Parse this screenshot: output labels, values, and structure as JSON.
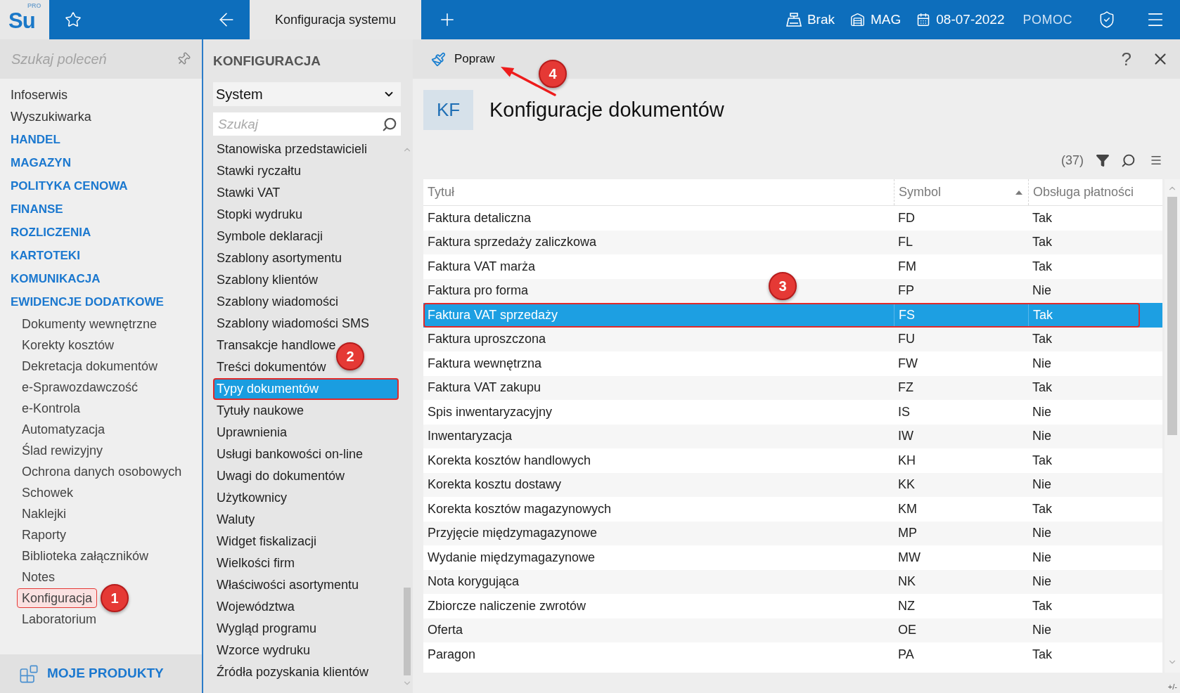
{
  "top_bar": {
    "logo": {
      "text": "Su",
      "superscript": "PRO"
    },
    "tab": "Konfiguracja systemu",
    "status_items": [
      {
        "kind": "register",
        "label": "Brak"
      },
      {
        "kind": "warehouse",
        "label": "MAG"
      },
      {
        "kind": "calendar",
        "label": "08-07-2022"
      }
    ],
    "help_link": "POMOC"
  },
  "sidebar": {
    "search": {
      "placeholder": "Szukaj poleceń"
    },
    "items": [
      {
        "kind": "link",
        "label": "Infoserwis"
      },
      {
        "kind": "link",
        "label": "Wyszukiwarka"
      },
      {
        "kind": "section",
        "label": "HANDEL"
      },
      {
        "kind": "section",
        "label": "MAGAZYN"
      },
      {
        "kind": "section",
        "label": "POLITYKA CENOWA"
      },
      {
        "kind": "section",
        "label": "FINANSE"
      },
      {
        "kind": "section",
        "label": "ROZLICZENIA"
      },
      {
        "kind": "section",
        "label": "KARTOTEKI"
      },
      {
        "kind": "section",
        "label": "KOMUNIKACJA"
      },
      {
        "kind": "section",
        "label": "EWIDENCJE DODATKOWE",
        "children": [
          {
            "label": "Dokumenty wewnętrzne",
            "highlighted": false
          },
          {
            "label": "Korekty kosztów",
            "highlighted": false
          },
          {
            "label": "Dekretacja dokumentów",
            "highlighted": false
          },
          {
            "label": "e-Sprawozdawczość",
            "highlighted": false
          },
          {
            "label": "e-Kontrola",
            "highlighted": false
          },
          {
            "label": "Automatyzacja",
            "highlighted": false
          },
          {
            "label": "Ślad rewizyjny",
            "highlighted": false
          },
          {
            "label": "Ochrona danych osobowych",
            "highlighted": false
          },
          {
            "label": "Schowek",
            "highlighted": false
          },
          {
            "label": "Naklejki",
            "highlighted": false
          },
          {
            "label": "Raporty",
            "highlighted": false
          },
          {
            "label": "Biblioteka załączników",
            "highlighted": false
          },
          {
            "label": "Notes",
            "highlighted": false
          },
          {
            "label": "Konfiguracja",
            "highlighted": true,
            "callout": "1"
          },
          {
            "label": "Laboratorium",
            "highlighted": false
          }
        ]
      }
    ],
    "footer": "MOJE PRODUKTY"
  },
  "config_panel": {
    "title": "KONFIGURACJA",
    "dropdown": {
      "value": "System"
    },
    "search": {
      "placeholder": "Szukaj"
    },
    "items": [
      {
        "label": "Stanowiska przedstawicieli",
        "selected": false,
        "highlighted": false
      },
      {
        "label": "Stawki ryczałtu",
        "selected": false,
        "highlighted": false
      },
      {
        "label": "Stawki VAT",
        "selected": false,
        "highlighted": false
      },
      {
        "label": "Stopki wydruku",
        "selected": false,
        "highlighted": false
      },
      {
        "label": "Symbole deklaracji",
        "selected": false,
        "highlighted": false
      },
      {
        "label": "Szablony asortymentu",
        "selected": false,
        "highlighted": false
      },
      {
        "label": "Szablony klientów",
        "selected": false,
        "highlighted": false
      },
      {
        "label": "Szablony wiadomości",
        "selected": false,
        "highlighted": false
      },
      {
        "label": "Szablony wiadomości SMS",
        "selected": false,
        "highlighted": false
      },
      {
        "label": "Transakcje handlowe",
        "selected": false,
        "highlighted": false
      },
      {
        "label": "Treści dokumentów",
        "selected": false,
        "highlighted": false
      },
      {
        "label": "Typy dokumentów",
        "selected": true,
        "highlighted": true,
        "callout": "2"
      },
      {
        "label": "Tytuły naukowe",
        "selected": false,
        "highlighted": false
      },
      {
        "label": "Uprawnienia",
        "selected": false,
        "highlighted": false
      },
      {
        "label": "Usługi bankowości on-line",
        "selected": false,
        "highlighted": false
      },
      {
        "label": "Uwagi do dokumentów",
        "selected": false,
        "highlighted": false
      },
      {
        "label": "Użytkownicy",
        "selected": false,
        "highlighted": false
      },
      {
        "label": "Waluty",
        "selected": false,
        "highlighted": false
      },
      {
        "label": "Widget fiskalizacji",
        "selected": false,
        "highlighted": false
      },
      {
        "label": "Wielkości firm",
        "selected": false,
        "highlighted": false
      },
      {
        "label": "Właściwości asortymentu",
        "selected": false,
        "highlighted": false
      },
      {
        "label": "Województwa",
        "selected": false,
        "highlighted": false
      },
      {
        "label": "Wygląd programu",
        "selected": false,
        "highlighted": false
      },
      {
        "label": "Wzorce wydruku",
        "selected": false,
        "highlighted": false
      },
      {
        "label": "Źródła pozyskania klientów",
        "selected": false,
        "highlighted": false
      }
    ]
  },
  "main": {
    "toolbar": {
      "edit_button": {
        "label": "Popraw",
        "callout": "4"
      },
      "help_button": "?"
    },
    "header": {
      "badge": "KF",
      "title": "Konfiguracje dokumentów"
    },
    "count": "(37)",
    "table": {
      "columns": [
        {
          "label": "Tytuł",
          "sorted_ascending": false
        },
        {
          "label": "Symbol",
          "sorted_ascending": true
        },
        {
          "label": "Obsługa płatności",
          "sorted_ascending": false
        }
      ],
      "rows": [
        {
          "cells": [
            "Faktura detaliczna",
            "FD",
            "Tak"
          ],
          "selected": false,
          "highlighted": false
        },
        {
          "cells": [
            "Faktura sprzedaży zaliczkowa",
            "FL",
            "Tak"
          ],
          "selected": false,
          "highlighted": false
        },
        {
          "cells": [
            "Faktura VAT marża",
            "FM",
            "Tak"
          ],
          "selected": false,
          "highlighted": false
        },
        {
          "cells": [
            "Faktura pro forma",
            "FP",
            "Nie"
          ],
          "selected": false,
          "highlighted": false
        },
        {
          "cells": [
            "Faktura VAT sprzedaży",
            "FS",
            "Tak"
          ],
          "selected": true,
          "highlighted": true,
          "callout": "3"
        },
        {
          "cells": [
            "Faktura uproszczona",
            "FU",
            "Tak"
          ],
          "selected": false,
          "highlighted": false
        },
        {
          "cells": [
            "Faktura wewnętrzna",
            "FW",
            "Nie"
          ],
          "selected": false,
          "highlighted": false
        },
        {
          "cells": [
            "Faktura VAT zakupu",
            "FZ",
            "Tak"
          ],
          "selected": false,
          "highlighted": false
        },
        {
          "cells": [
            "Spis inwentaryzacyjny",
            "IS",
            "Nie"
          ],
          "selected": false,
          "highlighted": false
        },
        {
          "cells": [
            "Inwentaryzacja",
            "IW",
            "Nie"
          ],
          "selected": false,
          "highlighted": false
        },
        {
          "cells": [
            "Korekta kosztów handlowych",
            "KH",
            "Tak"
          ],
          "selected": false,
          "highlighted": false
        },
        {
          "cells": [
            "Korekta kosztu dostawy",
            "KK",
            "Nie"
          ],
          "selected": false,
          "highlighted": false
        },
        {
          "cells": [
            "Korekta kosztów magazynowych",
            "KM",
            "Tak"
          ],
          "selected": false,
          "highlighted": false
        },
        {
          "cells": [
            "Przyjęcie międzymagazynowe",
            "MP",
            "Nie"
          ],
          "selected": false,
          "highlighted": false
        },
        {
          "cells": [
            "Wydanie międzymagazynowe",
            "MW",
            "Nie"
          ],
          "selected": false,
          "highlighted": false
        },
        {
          "cells": [
            "Nota korygująca",
            "NK",
            "Nie"
          ],
          "selected": false,
          "highlighted": false
        },
        {
          "cells": [
            "Zbiorcze naliczenie zwrotów",
            "NZ",
            "Tak"
          ],
          "selected": false,
          "highlighted": false
        },
        {
          "cells": [
            "Oferta",
            "OE",
            "Nie"
          ],
          "selected": false,
          "highlighted": false
        },
        {
          "cells": [
            "Paragon",
            "PA",
            "Tak"
          ],
          "selected": false,
          "highlighted": false
        }
      ]
    },
    "footer": "+/-"
  }
}
